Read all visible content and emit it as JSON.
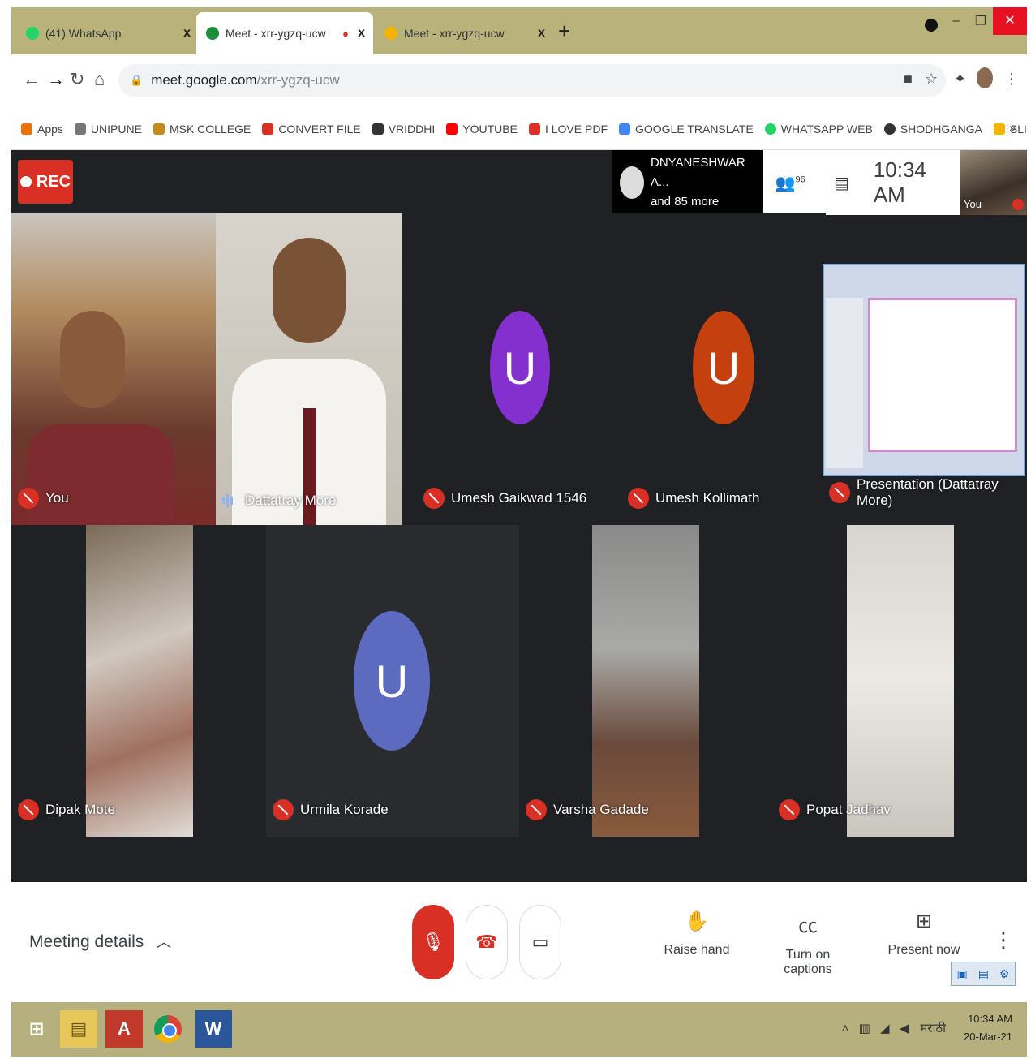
{
  "browser": {
    "tabs": [
      {
        "title": "(41) WhatsApp",
        "favicon_color": "#25d366",
        "active": false
      },
      {
        "title": "Meet - xrr-ygzq-ucw",
        "favicon_color": "#1e8e3e",
        "active": true
      },
      {
        "title": "Meet - xrr-ygzq-ucw",
        "favicon_color": "#f4b400",
        "active": false
      }
    ],
    "new_tab": "+",
    "close_glyph": "x",
    "url_host": "meet.google.com",
    "url_path": "/xrr-ygzq-ucw",
    "bookmarks": [
      {
        "label": "Apps",
        "color": "#e8710a"
      },
      {
        "label": "UNIPUNE",
        "color": "#777777"
      },
      {
        "label": "MSK COLLEGE",
        "color": "#c58a1c"
      },
      {
        "label": "CONVERT FILE",
        "color": "#d93025"
      },
      {
        "label": "VRIDDHI",
        "color": "#333333"
      },
      {
        "label": "YOUTUBE",
        "color": "#ff0000"
      },
      {
        "label": "I LOVE PDF",
        "color": "#d93025"
      },
      {
        "label": "GOOGLE TRANSLATE",
        "color": "#4285f4"
      },
      {
        "label": "WHATSAPP WEB",
        "color": "#25d366"
      },
      {
        "label": "SHODHGANGA",
        "color": "#333333"
      },
      {
        "label": "SLIDESHARE",
        "color": "#f4b400"
      }
    ],
    "bookmarks_more": "»"
  },
  "meet": {
    "rec_label": "REC",
    "presenter": {
      "name": "DNYANESHWAR A...",
      "more": "and 85 more"
    },
    "people_count": "96",
    "time": "10:34 AM",
    "self_label": "You",
    "tiles": {
      "you": "You",
      "dattatray": "Dattatray More",
      "umesh_g": "Umesh Gaikwad 1546",
      "umesh_k": "Umesh Kollimath",
      "presentation": "Presentation (Dattatray More)",
      "dipak": "Dipak Mote",
      "urmila": "Urmila Korade",
      "varsha": "Varsha Gadade",
      "popat": "Popat Jadhav"
    },
    "avatars": {
      "umesh_g": {
        "letter": "U",
        "color": "#8430ce"
      },
      "umesh_k": {
        "letter": "U",
        "color": "#c5400f"
      },
      "urmila": {
        "letter": "U",
        "color": "#5c6bc0"
      }
    }
  },
  "controls": {
    "meeting_details": "Meeting details",
    "raise_hand": "Raise hand",
    "captions": "Turn on captions",
    "present": "Present now"
  },
  "taskbar": {
    "clock_time": "10:34 AM",
    "clock_date": "20-Mar-21",
    "lang": "मराठी"
  },
  "colors": {
    "red": "#d93025",
    "dark": "#202124"
  }
}
